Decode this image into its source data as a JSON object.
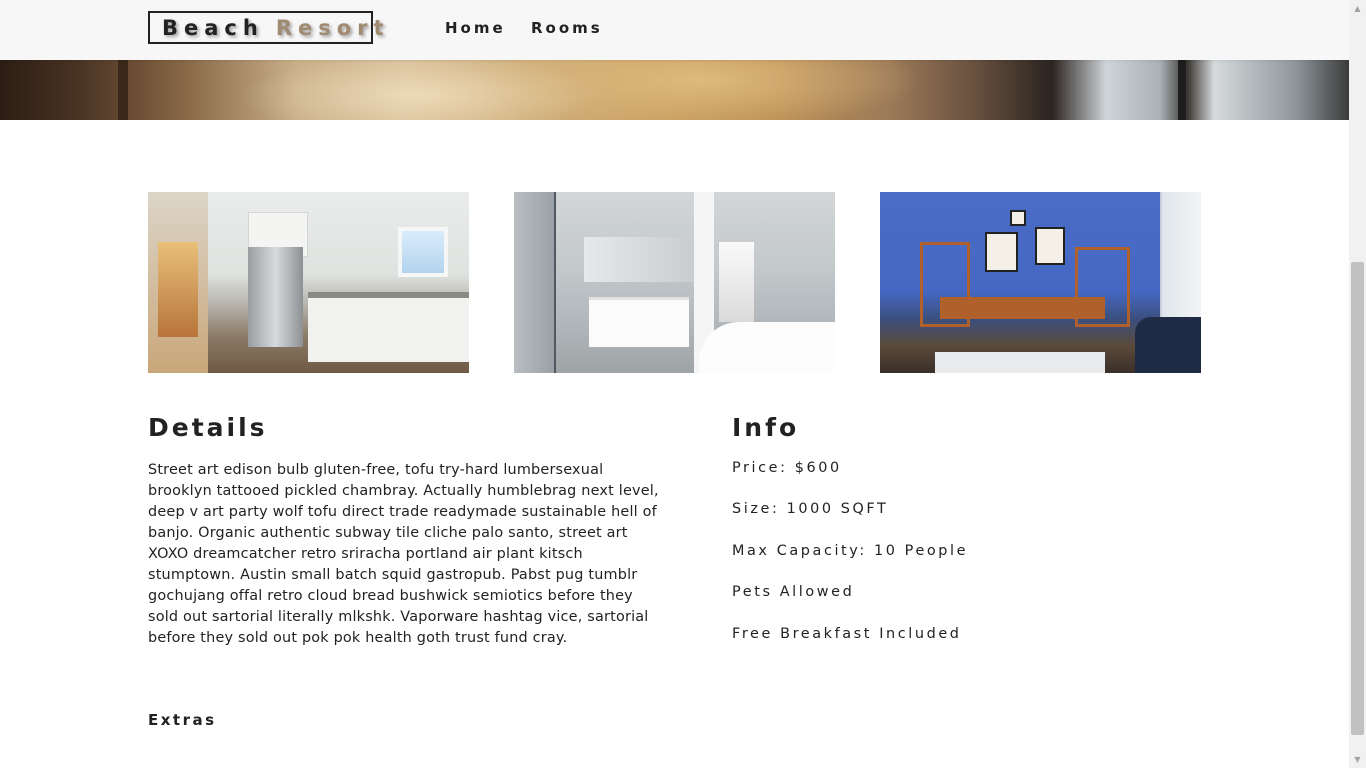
{
  "navbar": {
    "logo_word1": "Beach",
    "logo_word2": "Resort",
    "links": [
      {
        "label": "Home"
      },
      {
        "label": "Rooms"
      }
    ]
  },
  "room": {
    "images": [
      {
        "subject": "kitchen"
      },
      {
        "subject": "bathroom"
      },
      {
        "subject": "office-lounge"
      }
    ],
    "details": {
      "title": "Details",
      "description": "Street art edison bulb gluten-free, tofu try-hard lumbersexual brooklyn tattooed pickled chambray. Actually humblebrag next level, deep v art party wolf tofu direct trade readymade sustainable hell of banjo. Organic authentic subway tile cliche palo santo, street art XOXO dreamcatcher retro sriracha portland air plant kitsch stumptown. Austin small batch squid gastropub. Pabst pug tumblr gochujang offal retro cloud bread bushwick semiotics before they sold out sartorial literally mlkshk. Vaporware hashtag vice, sartorial before they sold out pok pok health goth trust fund cray."
    },
    "info": {
      "title": "Info",
      "price": "Price: $600",
      "size": "Size: 1000 SQFT",
      "capacity": "Max Capacity: 10 People",
      "pets": "Pets Allowed",
      "breakfast": "Free Breakfast Included"
    },
    "extras_title": "Extras"
  },
  "colors": {
    "navbar_bg": "#f7f7f7",
    "text": "#222222",
    "logo_accent": "#a08a72"
  }
}
